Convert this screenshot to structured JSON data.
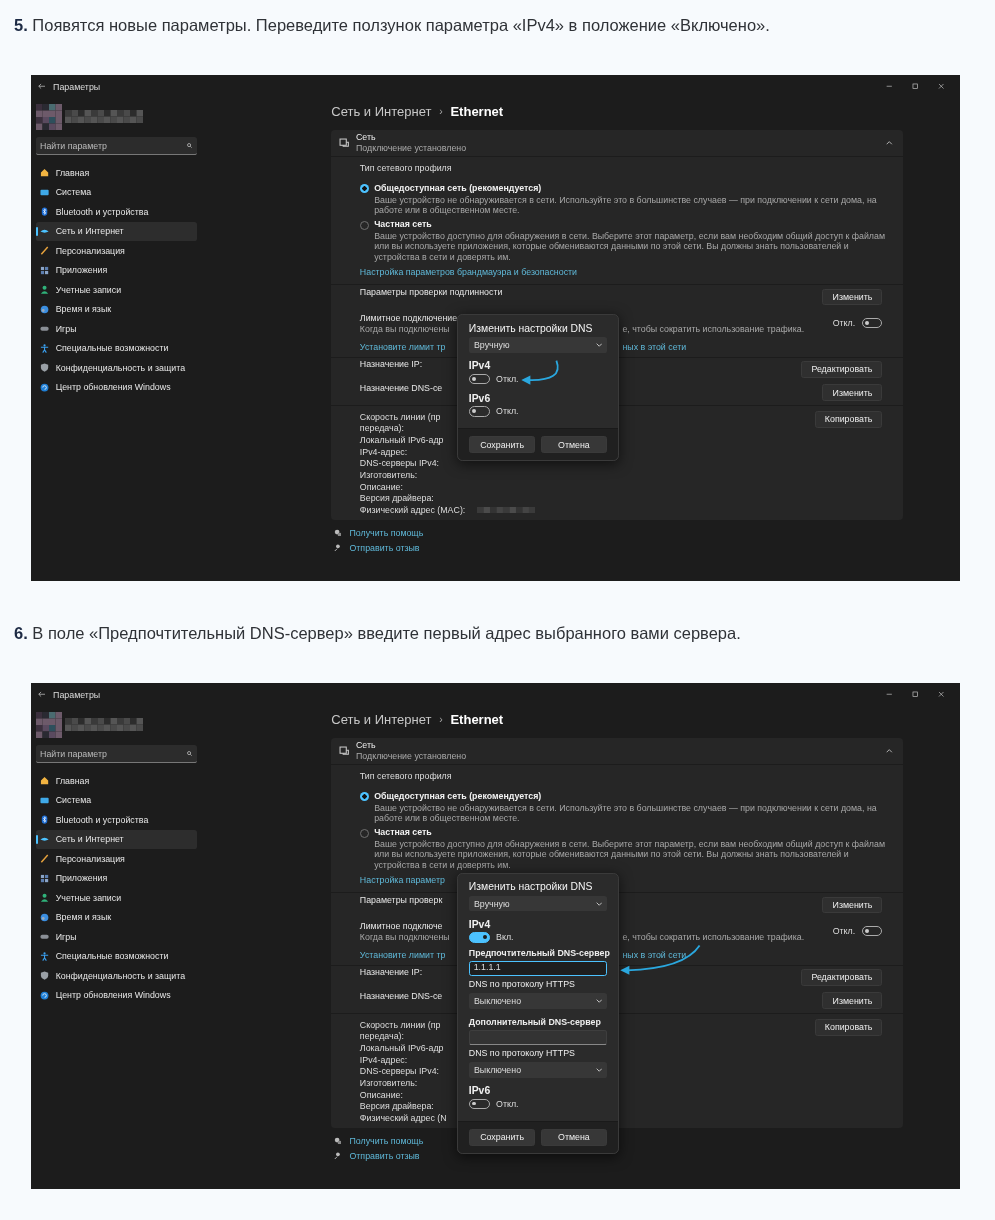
{
  "steps": [
    {
      "text": "**5.** Появятся новые параметры. Переведите ползунок параметра «IPv4» в положение «Включено».",
      "screen": {
        "window": {
          "title": "Параметры"
        },
        "search": {
          "placeholder": "Найти параметр"
        },
        "nav": [
          {
            "label": "Главная",
            "selected": false
          },
          {
            "label": "Система",
            "selected": false
          },
          {
            "label": "Bluetooth и устройства",
            "selected": false
          },
          {
            "label": "Сеть и Интернет",
            "selected": true
          },
          {
            "label": "Персонализация",
            "selected": false
          },
          {
            "label": "Приложения",
            "selected": false
          },
          {
            "label": "Учетные записи",
            "selected": false
          },
          {
            "label": "Время и язык",
            "selected": false
          },
          {
            "label": "Игры",
            "selected": false
          },
          {
            "label": "Специальные возможности",
            "selected": false
          },
          {
            "label": "Конфиденциальность и защита",
            "selected": false
          },
          {
            "label": "Центр обновления Windows",
            "selected": false
          }
        ],
        "breadcrumb": {
          "parent": "Сеть и Интернет",
          "separator": "›",
          "current": "Ethernet"
        },
        "network": {
          "title": "Сеть",
          "subtitle": "Подключение установлено",
          "expanded": true
        },
        "profile": {
          "heading": "Тип сетевого профиля",
          "options": [
            {
              "label": "Общедоступная сеть (рекомендуется)",
              "description": "Ваше устройство не обнаруживается в сети. Используйте это в большинстве случаев — при подключении к сети дома, на работе или в общественном месте.",
              "selected": true
            },
            {
              "label": "Частная сеть",
              "description": "Ваше устройство доступно для обнаружения в сети. Выберите этот параметр, если вам необходим общий доступ к файлам или вы используете приложения, которые обмениваются данными по этой сети. Вы должны знать пользователей и устройства в сети и доверять им.",
              "selected": false
            }
          ],
          "link": "Настройка параметров брандмауэра и безопасности"
        },
        "rows": [
          {
            "kind": "button",
            "label": "Параметры проверки подлинности",
            "button": "Изменить"
          },
          {
            "kind": "toggle",
            "label": "Лимитное подключение",
            "description": "Когда вы подключены",
            "description_tail": "е, чтобы сократить использование трафика.",
            "state_label": "Откл.",
            "on": false
          },
          {
            "kind": "link",
            "label": "Установите лимит тр",
            "tail": "ных в этой сети"
          },
          {
            "kind": "button",
            "label": "Назначение IP:",
            "button": "Редактировать"
          },
          {
            "kind": "button",
            "label": "Назначение DNS-се",
            "button": "Изменить"
          }
        ],
        "properties": {
          "labels": [
            "Скорость линии (пр",
            "передача):",
            "Локальный IPv6-адр",
            "IPv4-адрес:",
            "DNS-серверы IPv4:",
            "Изготовитель:",
            "Описание:",
            "Версия драйвера:",
            "Физический адрес (MAC):"
          ],
          "button": "Копировать",
          "mac_value": {
            "kind": "redacted"
          }
        },
        "footer_links": [
          "Получить помощь",
          "Отправить отзыв"
        ],
        "dialog": {
          "title": "Изменить настройки DNS",
          "mode": "Вручную",
          "items": [
            {
              "kind": "heading",
              "text": "IPv4"
            },
            {
              "kind": "toggle",
              "on": false,
              "label": "Откл."
            },
            {
              "kind": "heading",
              "text": "IPv6"
            },
            {
              "kind": "toggle",
              "on": false,
              "label": "Откл."
            }
          ],
          "buttons": [
            "Сохранить",
            "Отмена"
          ]
        }
      }
    },
    {
      "text": "**6.** В поле «Предпочтительный DNS-сервер» введите первый адрес выбранного вами сервера.",
      "screen": {
        "window": {
          "title": "Параметры"
        },
        "search": {
          "placeholder": "Найти параметр"
        },
        "nav": [
          {
            "label": "Главная",
            "selected": false
          },
          {
            "label": "Система",
            "selected": false
          },
          {
            "label": "Bluetooth и устройства",
            "selected": false
          },
          {
            "label": "Сеть и Интернет",
            "selected": true
          },
          {
            "label": "Персонализация",
            "selected": false
          },
          {
            "label": "Приложения",
            "selected": false
          },
          {
            "label": "Учетные записи",
            "selected": false
          },
          {
            "label": "Время и язык",
            "selected": false
          },
          {
            "label": "Игры",
            "selected": false
          },
          {
            "label": "Специальные возможности",
            "selected": false
          },
          {
            "label": "Конфиденциальность и защита",
            "selected": false
          },
          {
            "label": "Центр обновления Windows",
            "selected": false
          }
        ],
        "breadcrumb": {
          "parent": "Сеть и Интернет",
          "separator": "›",
          "current": "Ethernet"
        },
        "network": {
          "title": "Сеть",
          "subtitle": "Подключение установлено",
          "expanded": true
        },
        "profile": {
          "heading": "Тип сетевого профиля",
          "options": [
            {
              "label": "Общедоступная сеть (рекомендуется)",
              "description": "Ваше устройство не обнаруживается в сети. Используйте это в большинстве случаев — при подключении к сети дома, на работе или в общественном месте.",
              "selected": true
            },
            {
              "label": "Частная сеть",
              "description": "Ваше устройство доступно для обнаружения в сети. Выберите этот параметр, если вам необходим общий доступ к файлам или вы используете приложения, которые обмениваются данными по этой сети. Вы должны знать пользователей и устройства в сети и доверять им.",
              "selected": false
            }
          ],
          "link": "Настройка параметр"
        },
        "rows": [
          {
            "kind": "button",
            "label": "Параметры проверк",
            "button": "Изменить"
          },
          {
            "kind": "toggle",
            "label": "Лимитное подключе",
            "description": "Когда вы подключены",
            "description_tail": "е, чтобы сократить использование трафика.",
            "state_label": "Откл.",
            "on": false
          },
          {
            "kind": "link",
            "label": "Установите лимит тр",
            "tail": "ных в этой сети"
          },
          {
            "kind": "button",
            "label": "Назначение IP:",
            "button": "Редактировать"
          },
          {
            "kind": "button",
            "label": "Назначение DNS-се",
            "button": "Изменить"
          }
        ],
        "properties": {
          "labels": [
            "Скорость линии (пр",
            "передача):",
            "Локальный IPv6-адр",
            "IPv4-адрес:",
            "DNS-серверы IPv4:",
            "Изготовитель:",
            "Описание:",
            "Версия драйвера:",
            "Физический адрес (N"
          ],
          "button": "Копировать"
        },
        "footer_links": [
          "Получить помощь",
          "Отправить отзыв"
        ],
        "dialog": {
          "title": "Изменить настройки DNS",
          "mode": "Вручную",
          "items": [
            {
              "kind": "heading",
              "text": "IPv4"
            },
            {
              "kind": "toggle",
              "on": true,
              "label": "Вкл."
            },
            {
              "kind": "field",
              "label": "Предпочтительный DNS-сервер",
              "value": "1.1.1.1",
              "focused": true
            },
            {
              "kind": "select",
              "label": "DNS по протоколу HTTPS",
              "value": "Выключено"
            },
            {
              "kind": "field",
              "label": "Дополнительный DNS-сервер",
              "focused": false
            },
            {
              "kind": "select",
              "label": "DNS по протоколу HTTPS",
              "value": "Выключено"
            },
            {
              "kind": "heading",
              "text": "IPv6"
            },
            {
              "kind": "toggle",
              "on": false,
              "label": "Откл."
            }
          ],
          "buttons": [
            "Сохранить",
            "Отмена"
          ]
        }
      }
    }
  ]
}
